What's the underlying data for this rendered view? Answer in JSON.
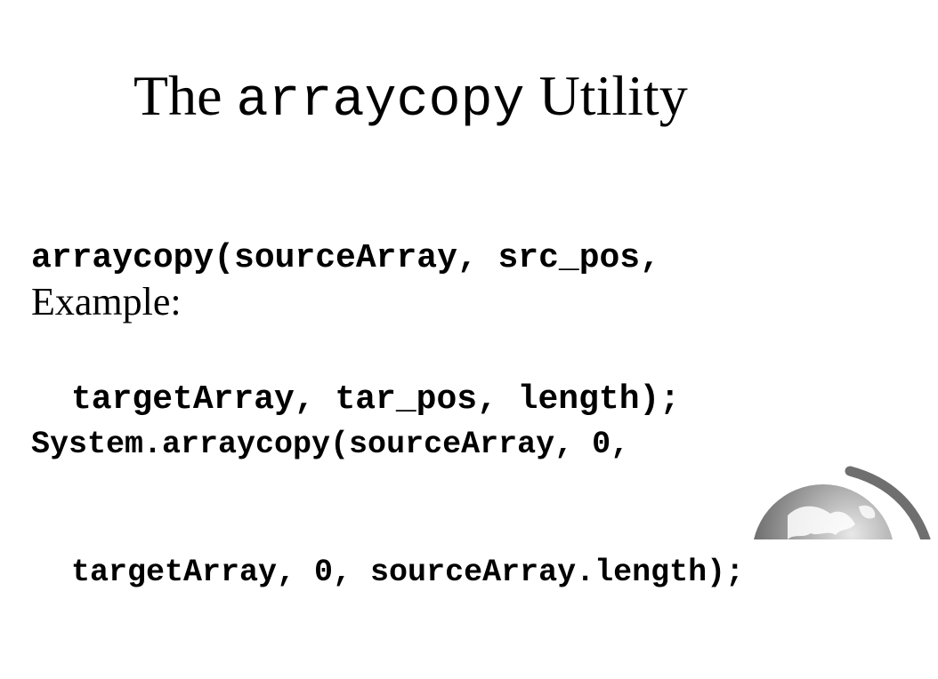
{
  "title": {
    "before": "The ",
    "code": "arraycopy",
    "after": " Utility"
  },
  "syntax": {
    "line1": "arraycopy(sourceArray, src_pos,",
    "line2": "targetArray, tar_pos, length);"
  },
  "example": {
    "label": "Example:",
    "line1": "System.arraycopy(sourceArray, 0,",
    "line2": "targetArray, 0, sourceArray.length);"
  },
  "logo": {
    "icon": "globe-logo-icon",
    "colors": {
      "dark": "#5a5a5a",
      "light": "#e8e8e8",
      "arc": "#6f6f6f"
    }
  }
}
